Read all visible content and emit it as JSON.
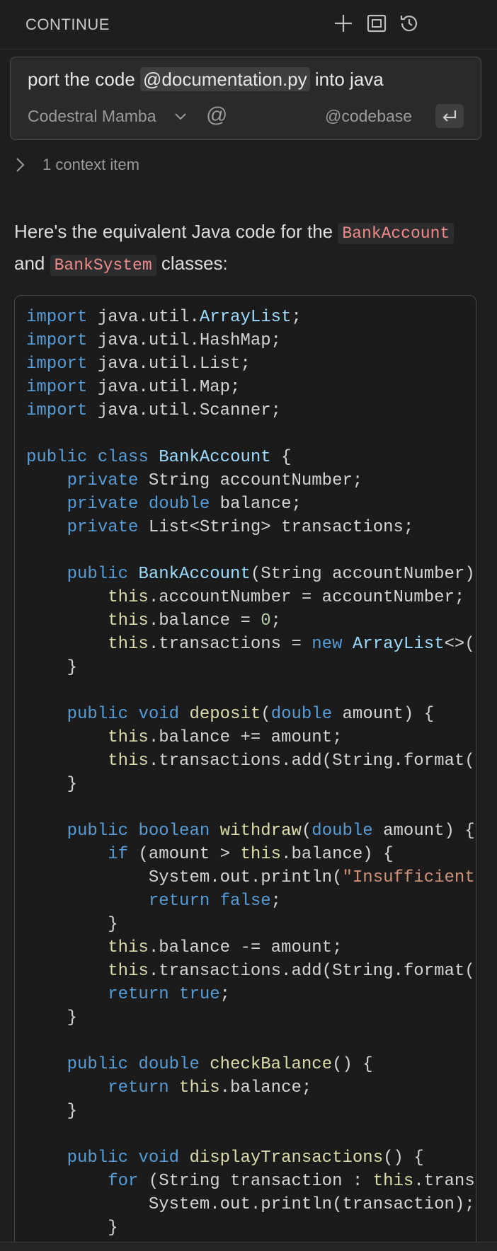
{
  "header": {
    "title": "CONTINUE",
    "icons": [
      "plus-icon",
      "fullscreen-icon",
      "history-icon"
    ]
  },
  "input": {
    "prompt_prefix": "port the code ",
    "mention": "@documentation.py",
    "prompt_suffix": " into java",
    "model": "Codestral Mamba",
    "at_symbol": "@",
    "codebase_label": "@codebase"
  },
  "context": {
    "label": "1 context item"
  },
  "response": {
    "intro_prefix": "Here's the equivalent Java code for the ",
    "class_a": "BankAccount",
    "middle": " and ",
    "class_b": "BankSystem",
    "intro_suffix": " classes:"
  },
  "code": {
    "language": "java",
    "lines": [
      "import java.util.ArrayList;",
      "import java.util.HashMap;",
      "import java.util.List;",
      "import java.util.Map;",
      "import java.util.Scanner;",
      "",
      "public class BankAccount {",
      "    private String accountNumber;",
      "    private double balance;",
      "    private List<String> transactions;",
      "",
      "    public BankAccount(String accountNumber)",
      "        this.accountNumber = accountNumber;",
      "        this.balance = 0;",
      "        this.transactions = new ArrayList<>(",
      "    }",
      "",
      "    public void deposit(double amount) {",
      "        this.balance += amount;",
      "        this.transactions.add(String.format(",
      "    }",
      "",
      "    public boolean withdraw(double amount) {",
      "        if (amount > this.balance) {",
      "            System.out.println(\"Insufficient",
      "            return false;",
      "        }",
      "        this.balance -= amount;",
      "        this.transactions.add(String.format(",
      "        return true;",
      "    }",
      "",
      "    public double checkBalance() {",
      "        return this.balance;",
      "    }",
      "",
      "    public void displayTransactions() {",
      "        for (String transaction : this.trans",
      "            System.out.println(transaction);",
      "        }",
      "    }"
    ]
  },
  "colors": {
    "background": "#1e1e1f",
    "keyword": "#569cd6",
    "function": "#dcdcaa",
    "type": "#9cdcfe",
    "string": "#ce9178",
    "number": "#b5cea8",
    "inline_code": "#f08a87"
  }
}
